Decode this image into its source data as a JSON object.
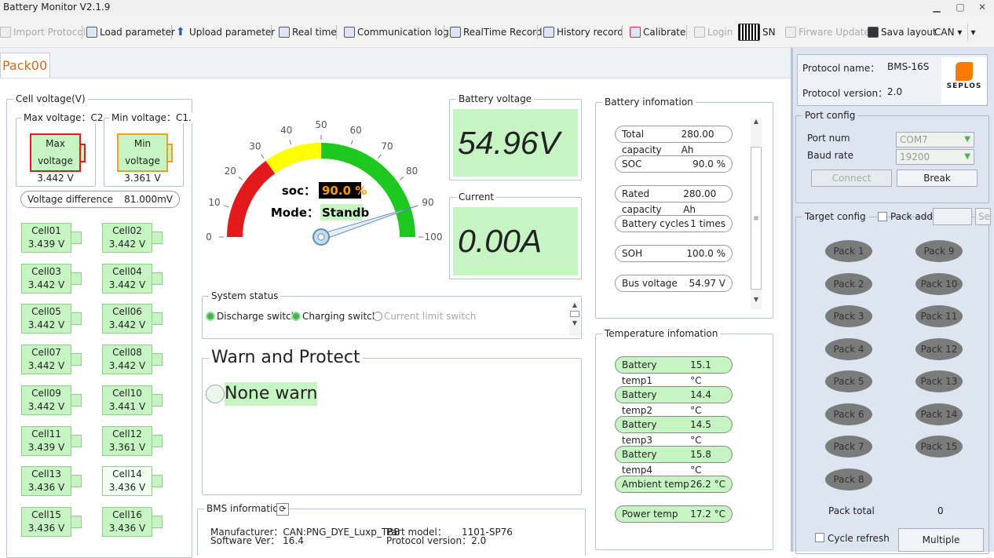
{
  "window": {
    "title": "Battery Monitor V2.1.9",
    "min": "▁",
    "max": "▢",
    "close": "✕"
  },
  "toolbar": {
    "import": "Import Protocol",
    "load": "Load parameter",
    "upload": "Upload parameter",
    "realtime": "Real time",
    "commlog": "Communication log",
    "rtrecord": "RealTime Record",
    "history": "History record",
    "calibrate": "Calibrate",
    "login": "Login",
    "sn": "SN",
    "firmware": "Firware Update",
    "savalayout": "Sava layout",
    "can": "CAN",
    "drop": "▾"
  },
  "tabs": [
    "Pack00"
  ],
  "cell_voltage": {
    "label": "Cell voltage(V)",
    "max_label": "Max voltage：C2",
    "min_label": "Min voltage：C1.",
    "max_title": "Max voltage",
    "max_value": "3.442 V",
    "min_title": "Min voltage",
    "min_value": "3.361 V",
    "diff_label": "Voltage difference",
    "diff_value": "81.000mV",
    "cells": [
      {
        "n": "Cell01",
        "v": "3.439 V"
      },
      {
        "n": "Cell02",
        "v": "3.442 V"
      },
      {
        "n": "Cell03",
        "v": "3.442 V"
      },
      {
        "n": "Cell04",
        "v": "3.442 V"
      },
      {
        "n": "Cell05",
        "v": "3.442 V"
      },
      {
        "n": "Cell06",
        "v": "3.442 V"
      },
      {
        "n": "Cell07",
        "v": "3.442 V"
      },
      {
        "n": "Cell08",
        "v": "3.442 V"
      },
      {
        "n": "Cell09",
        "v": "3.442 V"
      },
      {
        "n": "Cell10",
        "v": "3.441 V"
      },
      {
        "n": "Cell11",
        "v": "3.439 V"
      },
      {
        "n": "Cell12",
        "v": "3.361 V"
      },
      {
        "n": "Cell13",
        "v": "3.436 V"
      },
      {
        "n": "Cell14",
        "v": "3.436 V"
      },
      {
        "n": "Cell15",
        "v": "3.436 V"
      },
      {
        "n": "Cell16",
        "v": "3.436 V"
      }
    ]
  },
  "gauge": {
    "ticks": [
      "0",
      "10",
      "20",
      "30",
      "40",
      "50",
      "60",
      "70",
      "80",
      "90",
      "100"
    ],
    "soc_label": "soc：",
    "soc_value": "90.0 %",
    "mode_label": "Mode：",
    "mode_value": "Standb",
    "soc_fraction": 0.9
  },
  "battery_voltage": {
    "label": "Battery voltage",
    "value": "54.96V"
  },
  "current": {
    "label": "Current",
    "value": "0.00A"
  },
  "system_status": {
    "label": "System status",
    "items": [
      "Discharge switch",
      "Charging switch",
      "Current limit switch"
    ]
  },
  "warn": {
    "label": "Warn and Protect",
    "value": "None warn"
  },
  "bms": {
    "label": "BMS information",
    "manufacturer_label": "Manufacturer：",
    "manufacturer": "CAN:PNG_DYE_Luxp_TBB",
    "software_label": "Software Ver：",
    "software": "16.4",
    "model_label": "Part model：",
    "model": "1101-SP76",
    "protocol_label": "Protocol version：",
    "protocol": "2.0"
  },
  "battery_info": {
    "label": "Battery infomation",
    "rows": [
      {
        "k": "Total capacity",
        "v": "280.00 Ah"
      },
      {
        "k": "SOC",
        "v": "90.0 %"
      },
      {
        "k": "Rated capacity",
        "v": "280.00 Ah"
      },
      {
        "k": "Battery cycles",
        "v": "1 times"
      },
      {
        "k": "SOH",
        "v": "100.0 %"
      },
      {
        "k": "Bus voltage",
        "v": "54.97 V"
      }
    ]
  },
  "temp_info": {
    "label": "Temperature infomation",
    "rows": [
      {
        "k": "Battery temp1",
        "v": "15.1 °C"
      },
      {
        "k": "Battery temp2",
        "v": "14.4 °C"
      },
      {
        "k": "Battery temp3",
        "v": "14.5 °C"
      },
      {
        "k": "Battery temp4",
        "v": "15.8 °C"
      },
      {
        "k": "Ambient temp",
        "v": "26.2 °C"
      },
      {
        "k": "Power temp",
        "v": "17.2 °C"
      }
    ]
  },
  "right": {
    "protocol_name_label": "Protocol name：",
    "protocol_name": "BMS-16S",
    "protocol_version_label": "Protocol version：",
    "protocol_version": "2.0",
    "logo": "SEPLOS",
    "port_label": "Port config",
    "port_num_label": "Port num",
    "port_num": "COM7",
    "baud_label": "Baud rate",
    "baud": "19200",
    "connect": "Connect",
    "break": "Break",
    "target_label": "Target config",
    "pack_addr_label": "Pack addr",
    "se": "Se",
    "packs": [
      "Pack 1",
      "Pack 9",
      "Pack 2",
      "Pack 10",
      "Pack 3",
      "Pack 11",
      "Pack 4",
      "Pack 12",
      "Pack 5",
      "Pack 13",
      "Pack 6",
      "Pack 14",
      "Pack 7",
      "Pack 15",
      "Pack 8"
    ],
    "pack_total_label": "Pack total",
    "pack_total": "0",
    "cycle_refresh": "Cycle refresh",
    "multiple": "Multiple"
  },
  "colors": {
    "green": "#c6f5c3",
    "accent": "#d2691e",
    "pack": "#7b7b7b",
    "gauge_red": "#e31a1c",
    "gauge_yellow": "#ffff00",
    "gauge_green": "#1ec81e"
  }
}
